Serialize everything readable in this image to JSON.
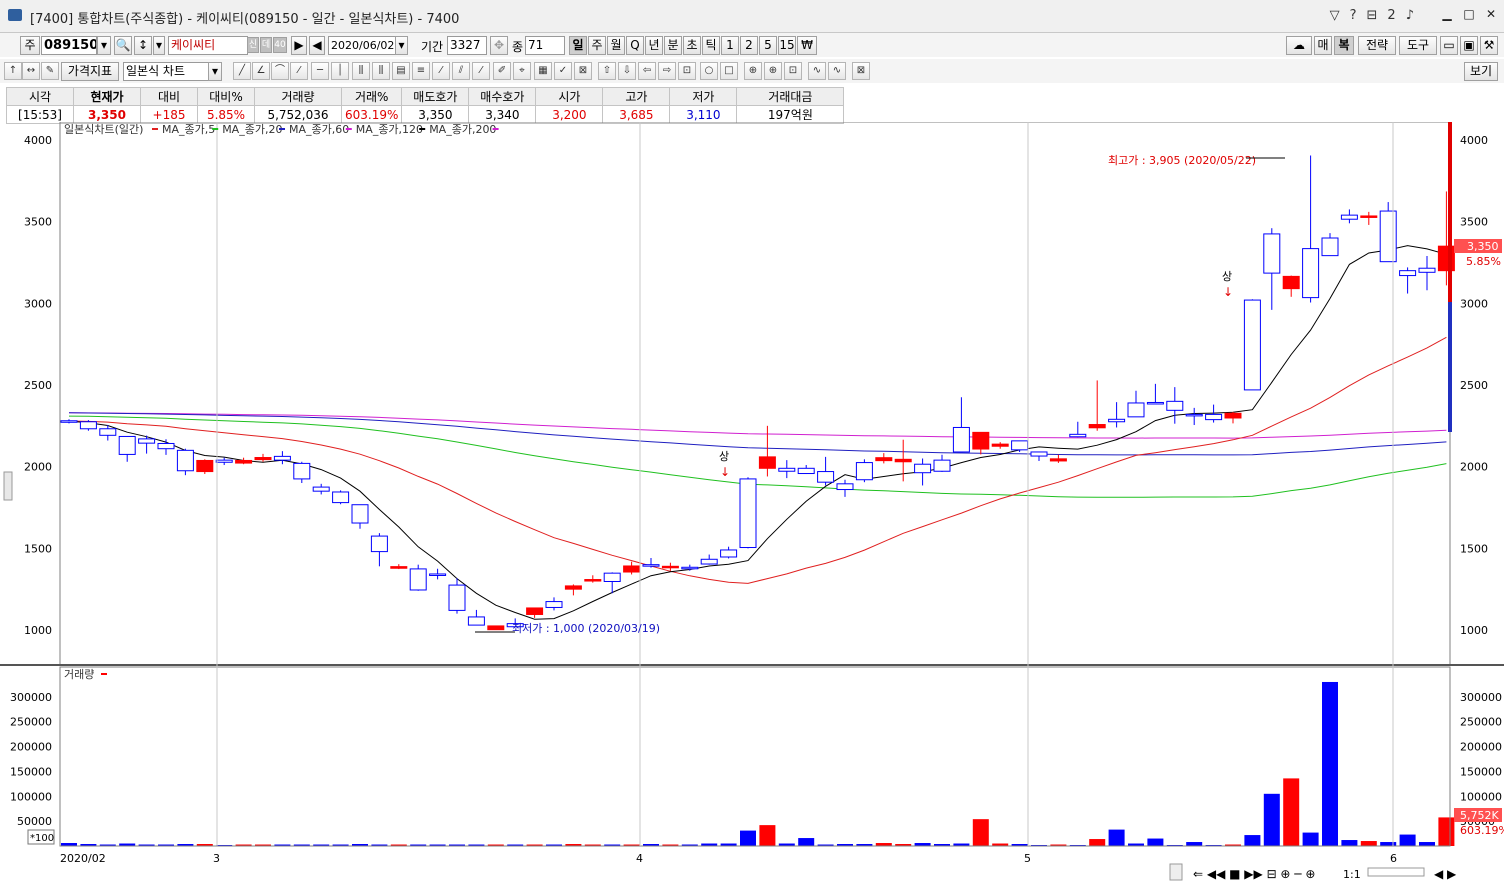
{
  "window": {
    "title": "[7400] 통합차트(주식종합) - 케이씨티(089150 - 일간 - 일본식차트) - 7400",
    "title_icons": [
      "▽",
      "?",
      "⊟",
      "2",
      "♪"
    ]
  },
  "toolbar1": {
    "market": "주",
    "code": "089150",
    "name": "케이씨티",
    "name_badges": [
      "신",
      "데",
      "40"
    ],
    "date": "2020/06/02",
    "period_label": "기간",
    "period_value": "3327",
    "count_label": "종",
    "count_value": "71",
    "interval_buttons": [
      "일",
      "주",
      "월",
      "Q",
      "년",
      "분",
      "초",
      "틱",
      "1",
      "2",
      "5",
      "15",
      "₩"
    ],
    "interval_selected": "일",
    "right_buttons": [
      "매",
      "복",
      "전략",
      "도구"
    ]
  },
  "toolbar2": {
    "indicator_label": "가격지표",
    "chart_type": "일본식 차트",
    "view_label": "보기"
  },
  "quote": {
    "headers": [
      "시각",
      "현재가",
      "대비",
      "대비%",
      "거래량",
      "거래%",
      "매도호가",
      "매수호가",
      "시가",
      "고가",
      "저가",
      "거래대금"
    ],
    "values": [
      "[15:53]",
      "3,350",
      "+185",
      "5.85%",
      "5,752,036",
      "603.19%",
      "3,350",
      "3,340",
      "3,200",
      "3,685",
      "3,110",
      "197억원"
    ]
  },
  "chart": {
    "price_legend": "일본식차트(일간)",
    "ma_series": [
      "MA_종가,5",
      "MA_종가,20",
      "MA_종가,60",
      "MA_종가,120",
      "MA_종가,200"
    ],
    "volume_legend": "거래량",
    "high_annotation": "최고가 : 3,905 (2020/05/22)",
    "low_annotation": "최저가 : 1,000 (2020/03/19)",
    "limit_up_label": "상",
    "price_axis_ticks": [
      "4000",
      "3500",
      "3000",
      "2500",
      "2000",
      "1500",
      "1000"
    ],
    "volume_axis_ticks": [
      "300000",
      "250000",
      "200000",
      "150000",
      "100000",
      "50000"
    ],
    "volume_unit_label": "*100",
    "x_labels": [
      "2020/02",
      "3",
      "4",
      "5",
      "6"
    ],
    "current_price_tag": "3,350",
    "current_change_tag": "5.85%",
    "current_volume_tag": "5,752K",
    "current_volume_pct_tag": "603.19%",
    "zoom_label": "1:1",
    "colors": {
      "up": "#ff0000",
      "down": "#0000ff",
      "ma5": "#000000",
      "ma20": "#e02020",
      "ma60": "#20c020",
      "ma120": "#2020c0",
      "ma200": "#d020d0"
    }
  },
  "chart_data": {
    "type": "candlestick",
    "xlabel": "",
    "ylabel": "",
    "ylim": [
      800,
      4150
    ],
    "volume_ylim": [
      0,
      340000
    ],
    "candles": [
      [
        2281,
        2290,
        2265,
        2275,
        6000
      ],
      [
        2275,
        2285,
        2220,
        2232,
        4000
      ],
      [
        2232,
        2255,
        2160,
        2192,
        3000
      ],
      [
        2185,
        2185,
        2030,
        2075,
        5000
      ],
      [
        2170,
        2190,
        2080,
        2144,
        3000
      ],
      [
        2142,
        2168,
        2072,
        2110,
        3000
      ],
      [
        2100,
        2110,
        1948,
        1975,
        4000
      ],
      [
        1970,
        2045,
        1955,
        2038,
        4000
      ],
      [
        2040,
        2055,
        2010,
        2027,
        2000
      ],
      [
        2022,
        2055,
        2015,
        2038,
        3000
      ],
      [
        2043,
        2078,
        2030,
        2056,
        3000
      ],
      [
        2063,
        2095,
        2015,
        2040,
        3000
      ],
      [
        2020,
        2030,
        1900,
        1925,
        3000
      ],
      [
        1875,
        1895,
        1830,
        1850,
        3000
      ],
      [
        1845,
        1855,
        1770,
        1780,
        3000
      ],
      [
        1767,
        1768,
        1620,
        1655,
        4000
      ],
      [
        1575,
        1593,
        1390,
        1480,
        3000
      ],
      [
        1378,
        1403,
        1373,
        1388,
        3000
      ],
      [
        1374,
        1400,
        1240,
        1245,
        3000
      ],
      [
        1343,
        1375,
        1310,
        1340,
        3000
      ],
      [
        1275,
        1317,
        1100,
        1120,
        3000
      ],
      [
        1080,
        1123,
        1030,
        1030,
        3000
      ],
      [
        1002,
        1025,
        1000,
        1025,
        3000
      ],
      [
        1039,
        1071,
        1018,
        1020,
        3000
      ],
      [
        1095,
        1136,
        1074,
        1135,
        3000
      ],
      [
        1174,
        1200,
        1120,
        1138,
        3000
      ],
      [
        1250,
        1279,
        1212,
        1270,
        4000
      ],
      [
        1304,
        1335,
        1290,
        1309,
        3000
      ],
      [
        1348,
        1353,
        1225,
        1297,
        3000
      ],
      [
        1355,
        1418,
        1340,
        1392,
        3000
      ],
      [
        1400,
        1441,
        1382,
        1395,
        4000
      ],
      [
        1387,
        1412,
        1362,
        1390,
        3000
      ],
      [
        1384,
        1400,
        1363,
        1378,
        3000
      ],
      [
        1433,
        1462,
        1400,
        1404,
        5000
      ],
      [
        1490,
        1510,
        1438,
        1447,
        5000
      ],
      [
        1925,
        1935,
        1500,
        1505,
        31000
      ],
      [
        1990,
        2250,
        1940,
        2060,
        42000
      ],
      [
        1990,
        2040,
        1930,
        1972,
        5000
      ],
      [
        1990,
        2010,
        1955,
        1958,
        16000
      ],
      [
        1970,
        2060,
        1885,
        1905,
        3000
      ],
      [
        1895,
        1920,
        1815,
        1860,
        4000
      ],
      [
        2025,
        2045,
        1905,
        1920,
        4000
      ],
      [
        2037,
        2083,
        2020,
        2055,
        6000
      ],
      [
        2030,
        2165,
        1910,
        2045,
        4000
      ],
      [
        2015,
        2050,
        1885,
        1963,
        6000
      ],
      [
        2040,
        2073,
        1968,
        1972,
        4000
      ],
      [
        2240,
        2425,
        2100,
        2090,
        5000
      ],
      [
        2108,
        2210,
        2075,
        2210,
        54000
      ],
      [
        2125,
        2150,
        2110,
        2138,
        5000
      ],
      [
        2158,
        2155,
        2090,
        2103,
        4000
      ],
      [
        2090,
        2080,
        2035,
        2065,
        2000
      ],
      [
        2035,
        2073,
        2023,
        2048,
        3000
      ],
      [
        2198,
        2275,
        2180,
        2183,
        2000
      ],
      [
        2238,
        2528,
        2220,
        2258,
        14000
      ],
      [
        2290,
        2395,
        2240,
        2275,
        33000
      ],
      [
        2390,
        2465,
        2338,
        2305,
        5000
      ],
      [
        2393,
        2507,
        2385,
        2390,
        15000
      ],
      [
        2400,
        2487,
        2263,
        2345,
        2000
      ],
      [
        2320,
        2360,
        2255,
        2313,
        8000
      ],
      [
        2320,
        2380,
        2270,
        2288,
        2000
      ],
      [
        2298,
        2335,
        2265,
        2327,
        3000
      ],
      [
        3020,
        3025,
        2485,
        2470,
        22000
      ],
      [
        3425,
        3460,
        2960,
        3185,
        105000
      ],
      [
        3090,
        3170,
        3040,
        3165,
        136000
      ],
      [
        3335,
        3905,
        3005,
        3035,
        27000
      ],
      [
        3400,
        3430,
        3305,
        3292,
        330000
      ],
      [
        3540,
        3575,
        3490,
        3515,
        12000
      ],
      [
        3528,
        3560,
        3480,
        3535,
        10000
      ],
      [
        3565,
        3620,
        3285,
        3255,
        8000
      ],
      [
        3200,
        3220,
        3060,
        3170,
        23000
      ],
      [
        3215,
        3290,
        3080,
        3190,
        8000
      ],
      [
        3200,
        3685,
        3110,
        3350,
        57520
      ]
    ]
  }
}
